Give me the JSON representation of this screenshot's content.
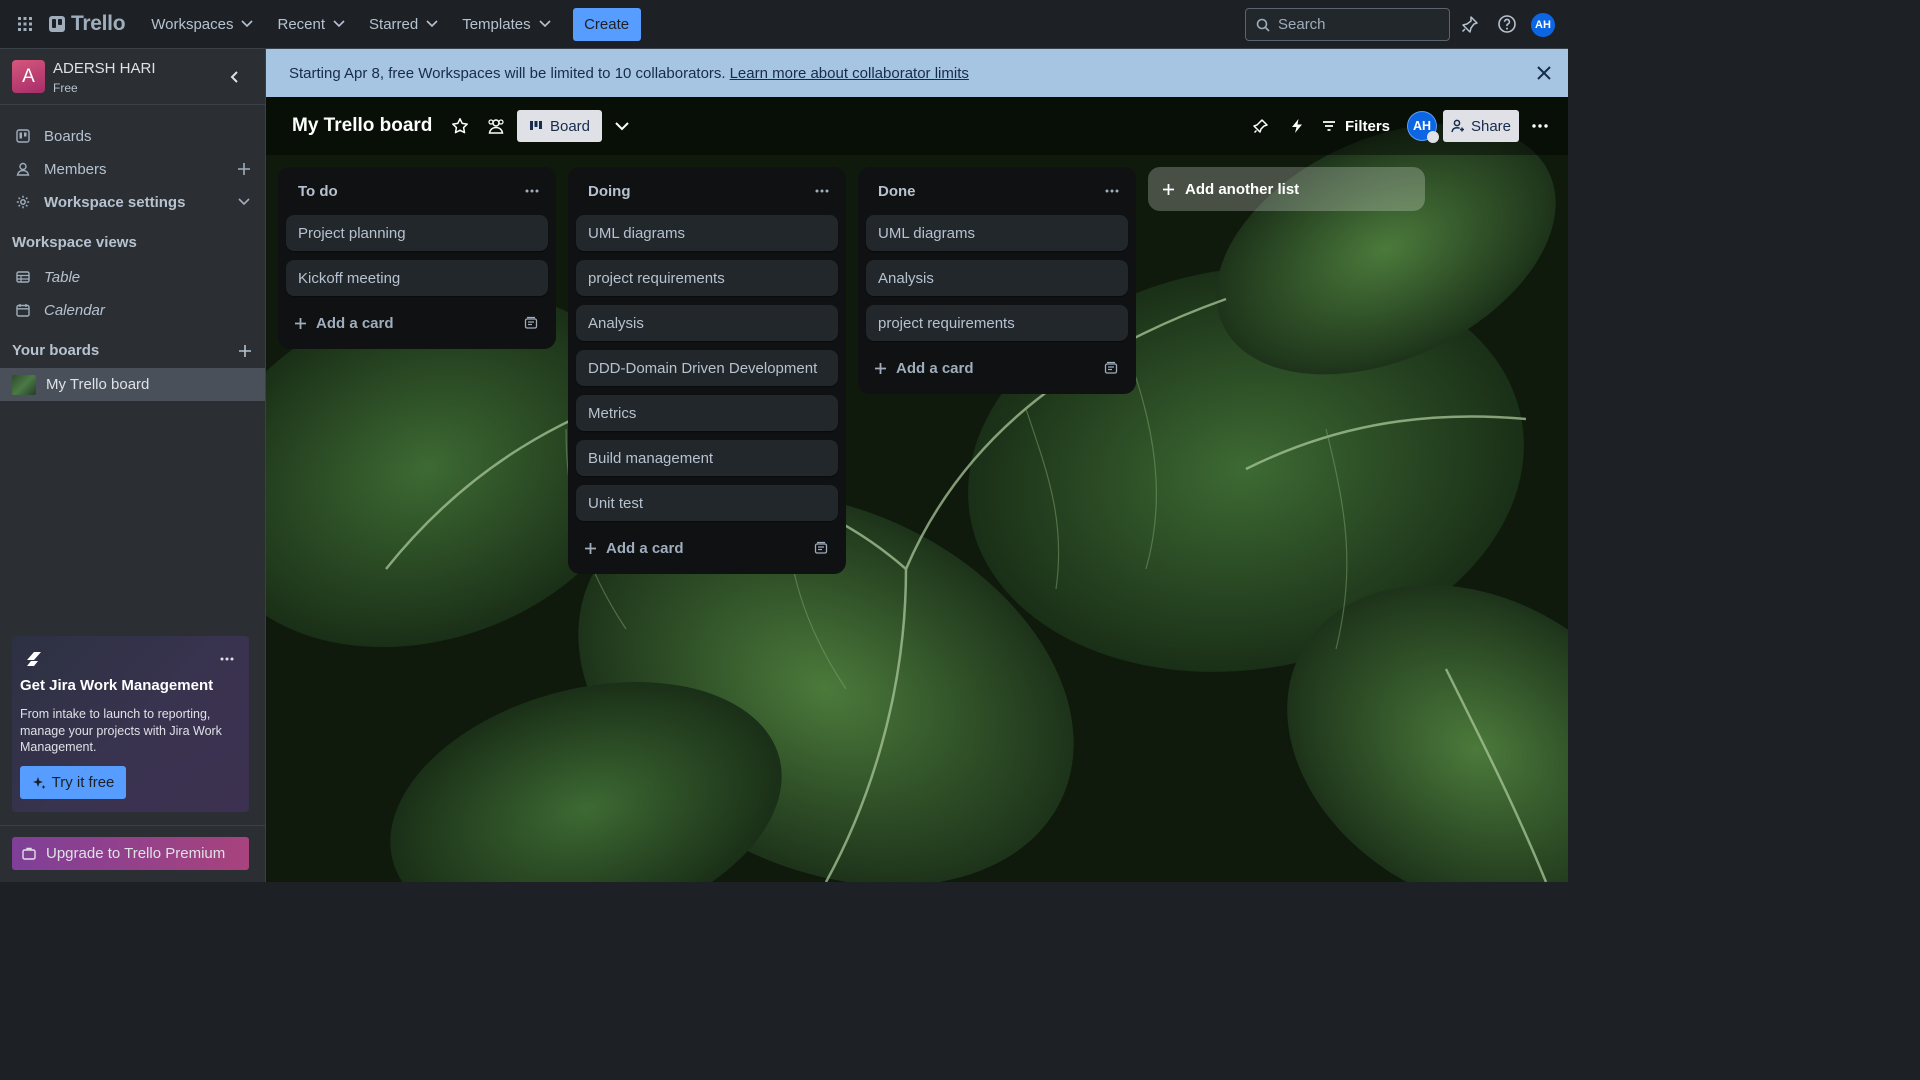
{
  "topnav": {
    "brand": "Trello",
    "menu": [
      {
        "label": "Workspaces"
      },
      {
        "label": "Recent"
      },
      {
        "label": "Starred"
      },
      {
        "label": "Templates"
      }
    ],
    "create_label": "Create",
    "search_placeholder": "Search",
    "avatar_initials": "AH"
  },
  "sidebar": {
    "workspace_initial": "A",
    "workspace_name": "ADERSH HARI",
    "workspace_plan": "Free",
    "nav": {
      "boards": "Boards",
      "members": "Members",
      "workspace_settings": "Workspace settings"
    },
    "views_heading": "Workspace views",
    "views": {
      "table": "Table",
      "calendar": "Calendar"
    },
    "your_boards_heading": "Your boards",
    "boards": [
      {
        "label": "My Trello board"
      }
    ],
    "promo": {
      "title": "Get Jira Work Management",
      "text": "From intake to launch to reporting, manage your projects with Jira Work Management.",
      "button": "Try it free"
    },
    "upgrade_label": "Upgrade to Trello Premium"
  },
  "banner": {
    "text": "Starting Apr 8, free Workspaces will be limited to 10 collaborators.",
    "link": "Learn more about collaborator limits"
  },
  "board": {
    "title": "My Trello board",
    "view_label": "Board",
    "filters_label": "Filters",
    "avatar_initials": "AH",
    "share_label": "Share",
    "add_list_label": "Add another list",
    "add_card_label": "Add a card",
    "lists": [
      {
        "title": "To do",
        "cards": [
          "Project planning",
          "Kickoff meeting"
        ]
      },
      {
        "title": "Doing",
        "cards": [
          "UML diagrams",
          "project requirements",
          "Analysis",
          "DDD-Domain Driven Development",
          "Metrics",
          "Build management",
          "Unit test"
        ]
      },
      {
        "title": "Done",
        "cards": [
          "UML diagrams",
          "Analysis",
          "project requirements"
        ]
      }
    ]
  },
  "colors": {
    "accent": "#579dff",
    "nav_bg": "#1d2125",
    "banner_bg": "#a6c5e2",
    "list_bg": "#0f1112",
    "card_bg": "#22272b"
  }
}
